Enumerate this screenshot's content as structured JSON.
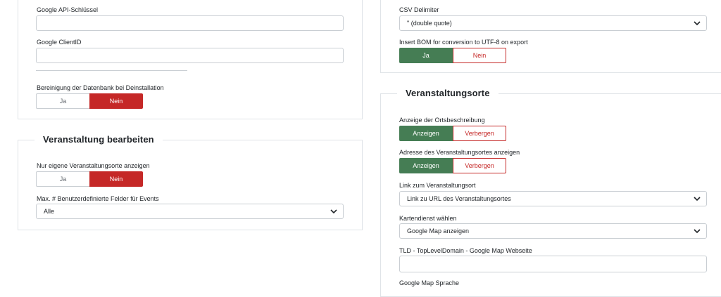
{
  "left_top": {
    "api_key_label": "Google API-Schlüssel",
    "client_id_label": "Google ClientID",
    "cleanup_label": "Bereinigung der Datenbank bei Deinstallation",
    "cleanup_yes": "Ja",
    "cleanup_no": "Nein",
    "cleanup_selected": "Nein"
  },
  "edit_event": {
    "legend": "Veranstaltung bearbeiten",
    "own_venues_label": "Nur eigene Veranstaltungsorte anzeigen",
    "own_venues_yes": "Ja",
    "own_venues_no": "Nein",
    "own_venues_selected": "Nein",
    "max_fields_label": "Max. # Benutzerdefinierte Felder für Events",
    "max_fields_value": "Alle"
  },
  "right_top": {
    "csv_delimiter_label": "CSV Delimiter",
    "csv_delimiter_value": "\" (double quote)",
    "bom_label": "Insert BOM for conversion to UTF-8 on export",
    "bom_yes": "Ja",
    "bom_no": "Nein",
    "bom_selected": "Ja"
  },
  "venues": {
    "legend": "Veranstaltungsorte",
    "show_desc_label": "Anzeige der Ortsbeschreibung",
    "show_desc_on": "Anzeigen",
    "show_desc_off": "Verbergen",
    "show_desc_selected": "Anzeigen",
    "address_label": "Adresse des Veranstaltungsortes anzeigen",
    "address_on": "Anzeigen",
    "address_off": "Verbergen",
    "address_selected": "Anzeigen",
    "link_label": "Link zum Veranstaltungsort",
    "link_value": "Link zu URL des Veranstaltungsortes",
    "map_service_label": "Kartendienst wählen",
    "map_service_value": "Google Map anzeigen",
    "tld_label": "TLD - TopLevelDomain - Google Map Webseite",
    "map_lang_label": "Google Map Sprache"
  },
  "colors": {
    "green": "#457d54",
    "red": "#c52827",
    "border": "#dfe3e7"
  }
}
